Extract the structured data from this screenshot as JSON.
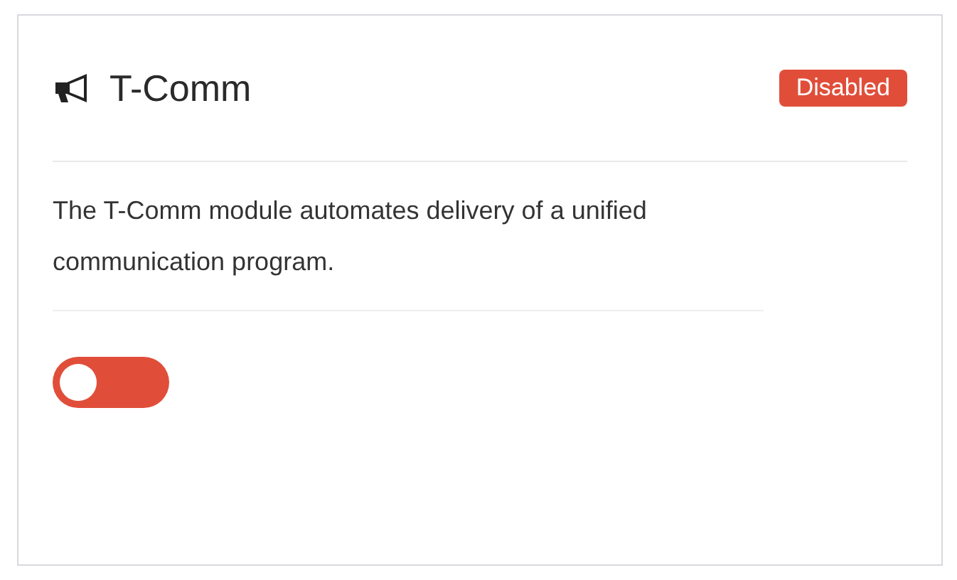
{
  "card": {
    "title": "T-Comm",
    "badge": {
      "label": "Disabled",
      "kind": "disabled"
    },
    "description": "The T-Comm module automates delivery of a unified communication program.",
    "toggle": {
      "on": false
    }
  }
}
